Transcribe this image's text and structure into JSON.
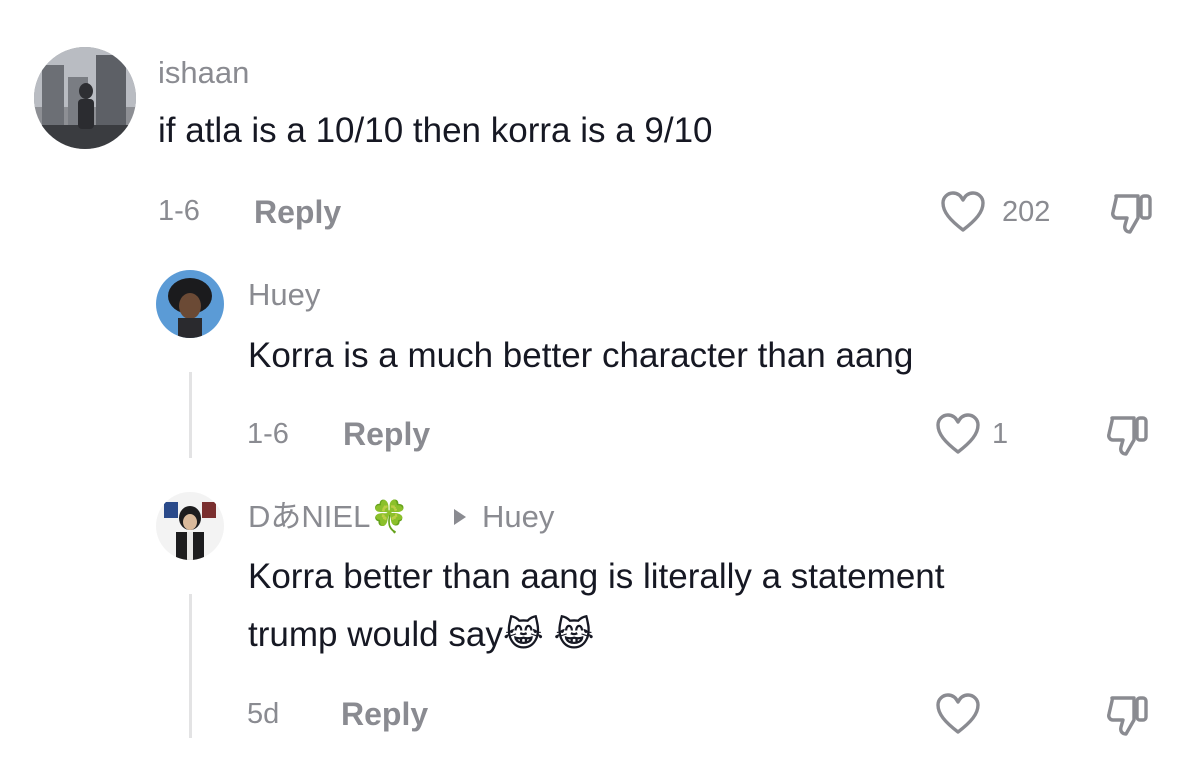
{
  "comments": [
    {
      "username": "ishaan",
      "text": "if atla is a 10/10 then korra is a 9/10",
      "date": "1-6",
      "reply_label": "Reply",
      "likes": "202"
    },
    {
      "username": "Huey",
      "text": "Korra is a much better character than aang",
      "date": "1-6",
      "reply_label": "Reply",
      "likes": "1"
    },
    {
      "username": "DあNIEL",
      "username_emoji": "🍀",
      "reply_to": "Huey",
      "text_line1": "Korra better than aang is literally a statement",
      "text_line2": "trump would say",
      "text_emoji": "😹 😹",
      "date": "5d",
      "reply_label": "Reply",
      "likes": ""
    }
  ],
  "icons": {
    "like": "heart-outline-icon",
    "dislike": "thumbs-down-icon",
    "reply_to_arrow": "triangle-right-icon"
  },
  "colors": {
    "text": "#161823",
    "secondary": "#8a8b91",
    "thread_line": "#e3e3e4"
  }
}
